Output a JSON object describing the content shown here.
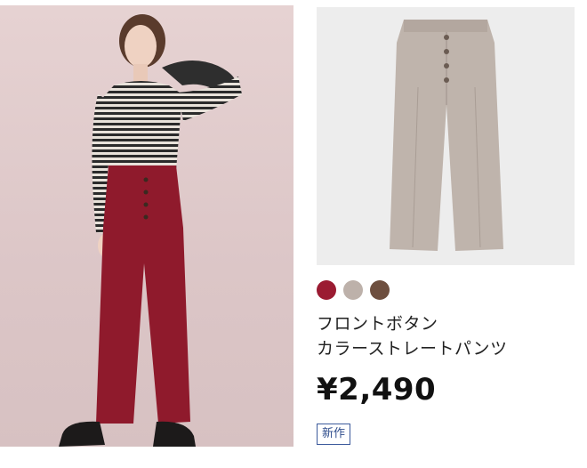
{
  "product": {
    "name_line1": "フロントボタン",
    "name_line2": "カラーストレートパンツ",
    "price": "¥2,490",
    "badge": "新作",
    "swatches": [
      {
        "name": "dark-red",
        "color": "#9b1b32"
      },
      {
        "name": "light-beige",
        "color": "#bdb1aa"
      },
      {
        "name": "brown",
        "color": "#6e4f3f"
      }
    ]
  },
  "colors": {
    "model_background": "#e2cdcd",
    "product_background": "#ededed",
    "pants_red": "#8f1a2c",
    "pants_taupe": "#bfb4ac",
    "badge_border": "#3c5a9c"
  }
}
